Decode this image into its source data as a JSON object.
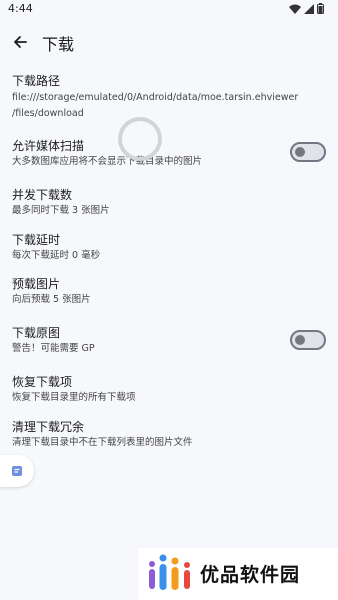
{
  "status_bar": {
    "time": "4:44"
  },
  "app_bar": {
    "title": "下载"
  },
  "settings": {
    "download_path": {
      "title": "下载路径",
      "path_lines": [
        "file:///storage/emulated/0/Android/data/moe.tarsin.ehviewer",
        "/files/download"
      ]
    },
    "allow_media_scan": {
      "title": "允许媒体扫描",
      "summary": "大多数图库应用将不会显示下载目录中的图片",
      "enabled": false
    },
    "concurrent_downloads": {
      "title": "并发下载数",
      "summary": "最多同时下载 3 张图片"
    },
    "download_delay": {
      "title": "下载延时",
      "summary": "每次下载延时 0 毫秒"
    },
    "preload_images": {
      "title": "预载图片",
      "summary": "向后预载 5 张图片"
    },
    "download_original": {
      "title": "下载原图",
      "summary": "警告！可能需要 GP",
      "enabled": false
    },
    "restore_downloads": {
      "title": "恢复下载项",
      "summary": "恢复下载目录里的所有下载项"
    },
    "clean_redundancy": {
      "title": "清理下载冗余",
      "summary": "清理下载目录中不在下载列表里的图片文件"
    }
  },
  "watermark": {
    "text": "优品软件园"
  },
  "colors": {
    "background": "#f6f8fb",
    "toggle_outline": "#73777f"
  }
}
